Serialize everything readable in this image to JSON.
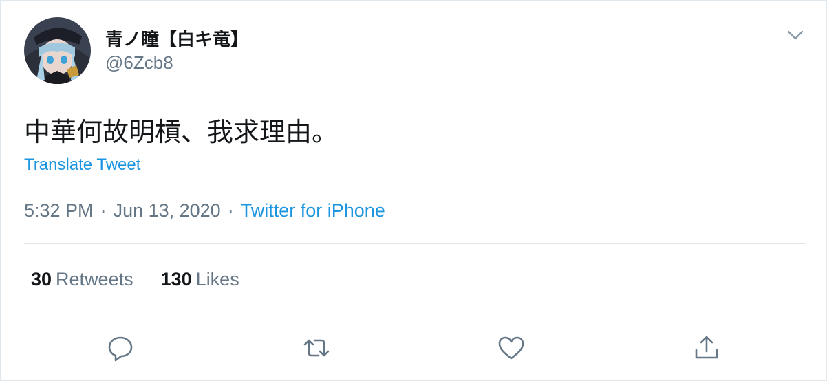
{
  "tweet": {
    "display_name": "青ノ瞳【白キ竜】",
    "handle": "@6Zcb8",
    "text": "中華何故明槓、我求理由。",
    "translate_label": "Translate Tweet",
    "time": "5:32 PM",
    "date": "Jun 13, 2020",
    "separator": "·",
    "source": "Twitter for iPhone"
  },
  "stats": {
    "retweets_count": "30",
    "retweets_label": "Retweets",
    "likes_count": "130",
    "likes_label": "Likes"
  },
  "icons": {
    "caret": "chevron-down-icon",
    "reply": "reply-icon",
    "retweet": "retweet-icon",
    "like": "heart-icon",
    "share": "share-icon"
  },
  "colors": {
    "link": "#1b95e0",
    "muted": "#657786",
    "text": "#14171a",
    "border": "#e1e8ed"
  }
}
